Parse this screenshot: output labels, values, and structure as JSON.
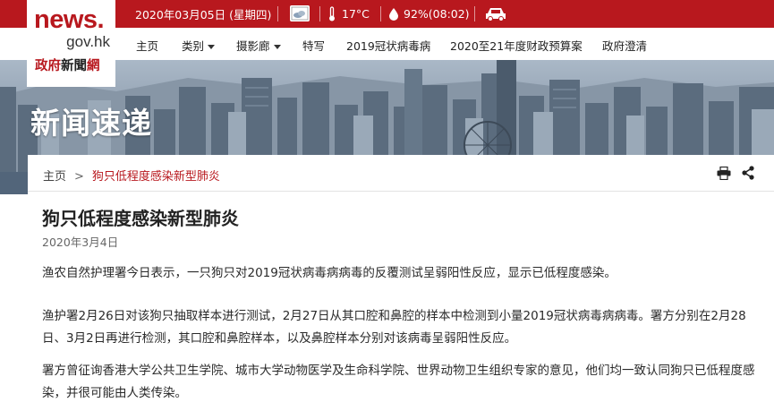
{
  "header": {
    "date": "2020年03月05日 (星期四)",
    "weather_icon": "cloudy-icon",
    "temperature": "17°C",
    "humidity": "92%(08:02)",
    "traffic_icon": "car-icon"
  },
  "logo": {
    "news": "news.",
    "gov": "gov.hk",
    "cn_part1": "政府",
    "cn_part2": "新聞",
    "cn_part3": "網"
  },
  "nav": {
    "items": [
      {
        "label": "主页"
      },
      {
        "label": "类别"
      },
      {
        "label": "摄影廊"
      },
      {
        "label": "特写"
      },
      {
        "label": "2019冠状病毒病"
      },
      {
        "label": "2020至21年度财政预算案"
      },
      {
        "label": "政府澄清"
      }
    ]
  },
  "banner": {
    "title": "新闻速递"
  },
  "breadcrumb": {
    "home": "主页",
    "separator": ">",
    "current": "狗只低程度感染新型肺炎"
  },
  "article": {
    "title": "狗只低程度感染新型肺炎",
    "date": "2020年3月4日",
    "paragraphs": [
      "渔农自然护理署今日表示，一只狗只对2019冠状病毒病病毒的反覆测试呈弱阳性反应，显示已低程度感染。",
      "渔护署2月26日对该狗只抽取样本进行测试，2月27日从其口腔和鼻腔的样本中检测到小量2019冠状病毒病病毒。署方分别在2月28日、3月2日再进行检测，其口腔和鼻腔样本，以及鼻腔样本分别对该病毒呈弱阳性反应。",
      "署方曾征询香港大学公共卫生学院、城市大学动物医学及生命科学院、世界动物卫生组织专家的意见，他们均一致认同狗只已低程度感染，并很可能由人类传染。"
    ]
  },
  "colors": {
    "brand_red": "#b8181e",
    "text": "#222222"
  }
}
